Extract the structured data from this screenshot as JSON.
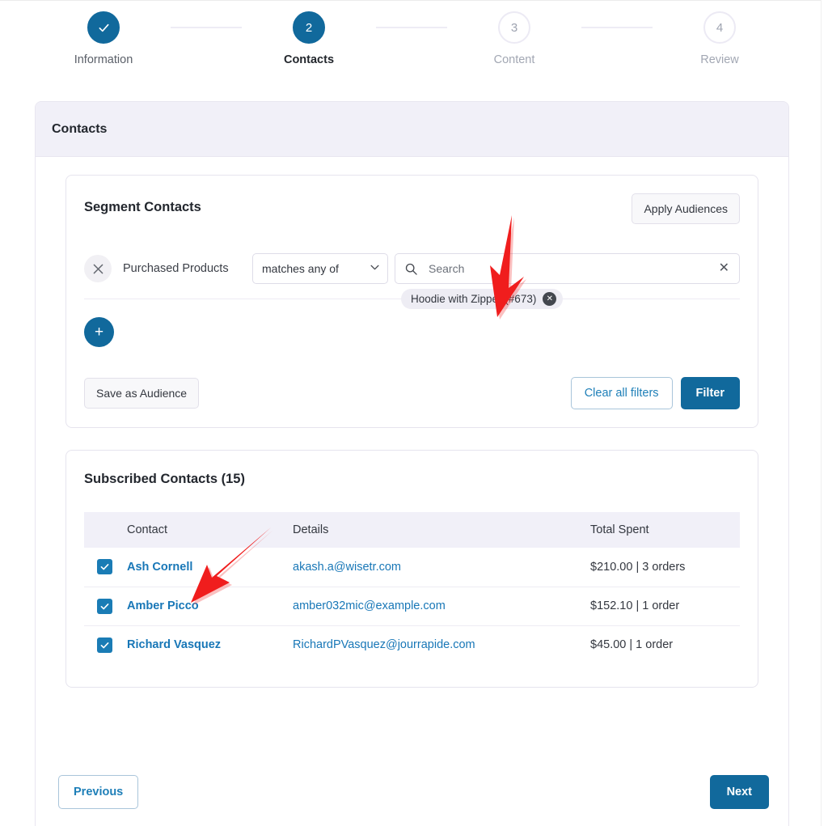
{
  "stepper": {
    "steps": [
      {
        "label": "Information",
        "marker": "check",
        "state": "done"
      },
      {
        "label": "Contacts",
        "marker": "2",
        "state": "active"
      },
      {
        "label": "Content",
        "marker": "3",
        "state": "todo"
      },
      {
        "label": "Review",
        "marker": "4",
        "state": "todo"
      }
    ]
  },
  "card": {
    "title": "Contacts"
  },
  "segment": {
    "title": "Segment Contacts",
    "apply_audiences_label": "Apply Audiences",
    "filter": {
      "remove_icon": "close-icon",
      "name": "Purchased Products",
      "condition_selected": "matches any of",
      "condition_options": [
        "matches any of"
      ],
      "search_placeholder": "Search",
      "search_value": "",
      "clear_icon": "close-icon",
      "chips": [
        {
          "label": "Hoodie with Zipper (#673)",
          "remove_icon": "close-circle-icon"
        }
      ]
    },
    "add_filter_label": "+",
    "save_as_audience_label": "Save as Audience",
    "clear_all_filters_label": "Clear all filters",
    "filter_label": "Filter"
  },
  "contacts": {
    "title": "Subscribed Contacts (15)",
    "columns": [
      "",
      "Contact",
      "Details",
      "Total Spent"
    ],
    "rows": [
      {
        "checked": true,
        "name": "Ash Cornell",
        "details": "akash.a@wisetr.com",
        "spent": "$210.00 | 3 orders"
      },
      {
        "checked": true,
        "name": "Amber Picco",
        "details": "amber032mic@example.com",
        "spent": "$152.10 | 1 order"
      },
      {
        "checked": true,
        "name": "Richard Vasquez",
        "details": "RichardPVasquez@jourrapide.com",
        "spent": "$45.00 | 1 order"
      }
    ]
  },
  "footer": {
    "previous_label": "Previous",
    "next_label": "Next"
  },
  "annotations": [
    {
      "name": "arrow-to-product-chip",
      "color": "#f01d1d"
    },
    {
      "name": "arrow-to-contact-column",
      "color": "#f01d1d"
    }
  ],
  "colors": {
    "primary": "#11699c",
    "link": "#1877b7",
    "header_bg": "#f1f0f8",
    "annotation_red": "#f01d1d"
  }
}
